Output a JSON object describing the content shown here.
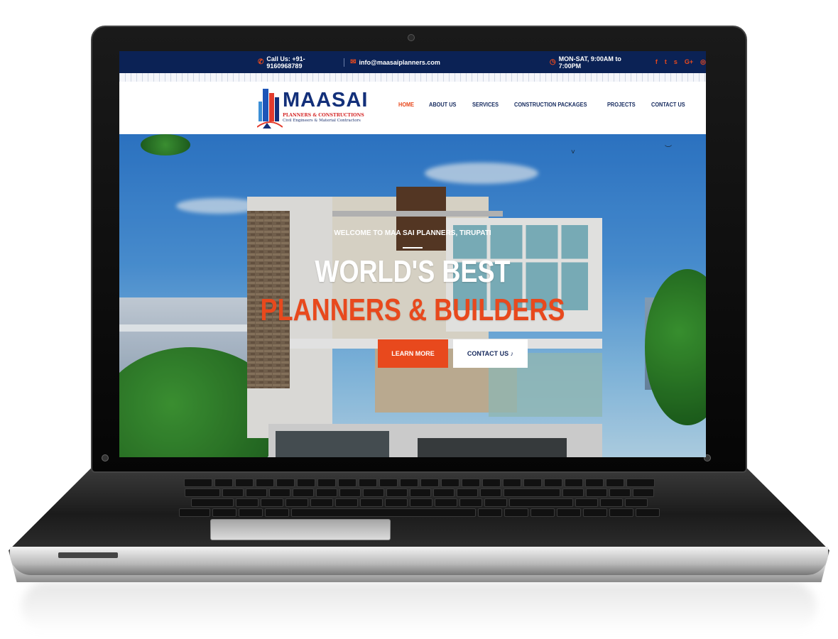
{
  "topbar": {
    "phone": "Call Us: +91-9160968789",
    "email": "info@maasaiplanners.com",
    "hours": "MON-SAT, 9:00AM to 7:00PM",
    "social_icons": [
      "facebook-icon",
      "twitter-icon",
      "skype-icon",
      "google-plus-icon",
      "instagram-icon"
    ],
    "social_glyphs": [
      "f",
      "t",
      "s",
      "G+",
      "◎"
    ]
  },
  "logo": {
    "word": "MAASAI",
    "tagline": "PLANNERS & CONSTRUCTIONS",
    "subtagline": "Civil Engineers & Material Contractors"
  },
  "nav": {
    "items": [
      "HOME",
      "ABOUT US",
      "SERVICES",
      "CONSTRUCTION PACKAGES",
      "PROJECTS",
      "CONTACT US"
    ],
    "active": "HOME"
  },
  "hero": {
    "welcome": "WELCOME TO MAA SAI PLANNERS, TIRUPATI",
    "headline_1": "WORLD'S BEST",
    "headline_2": "PLANNERS & BUILDERS",
    "learn_more": "LEARN MORE",
    "contact": "CONTACT US ♪"
  },
  "colors": {
    "brand_navy": "#0b2255",
    "accent_orange": "#e8491d",
    "nav_text": "#152a5e"
  }
}
